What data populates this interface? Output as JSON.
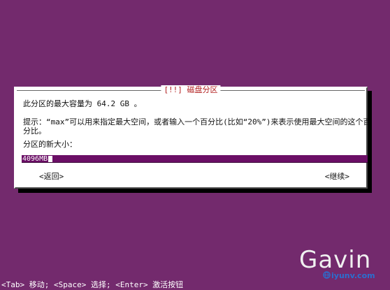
{
  "dialog": {
    "title": "[!!] 磁盘分区",
    "line_max": "此分区的最大容量为 64.2 GB 。",
    "hint_line1": "提示：“max”可以用来指定最大空间，或者输入一个百分比(比如“20%”)来表示使用最大空间的这个百",
    "hint_line2": "分比。",
    "size_label": "分区的新大小：",
    "size_value": "4096MB",
    "back_label": "<返回>",
    "continue_label": "<继续>"
  },
  "status_bar": {
    "text": "<Tab> 移动; <Space> 选择; <Enter> 激活按钮"
  },
  "watermark": {
    "name": "Gavin",
    "site": "iyunv.com"
  },
  "colors": {
    "background": "#732a6d",
    "dialog": "#ffffff",
    "title": "#b11d1d",
    "field": "#6b0f66"
  }
}
